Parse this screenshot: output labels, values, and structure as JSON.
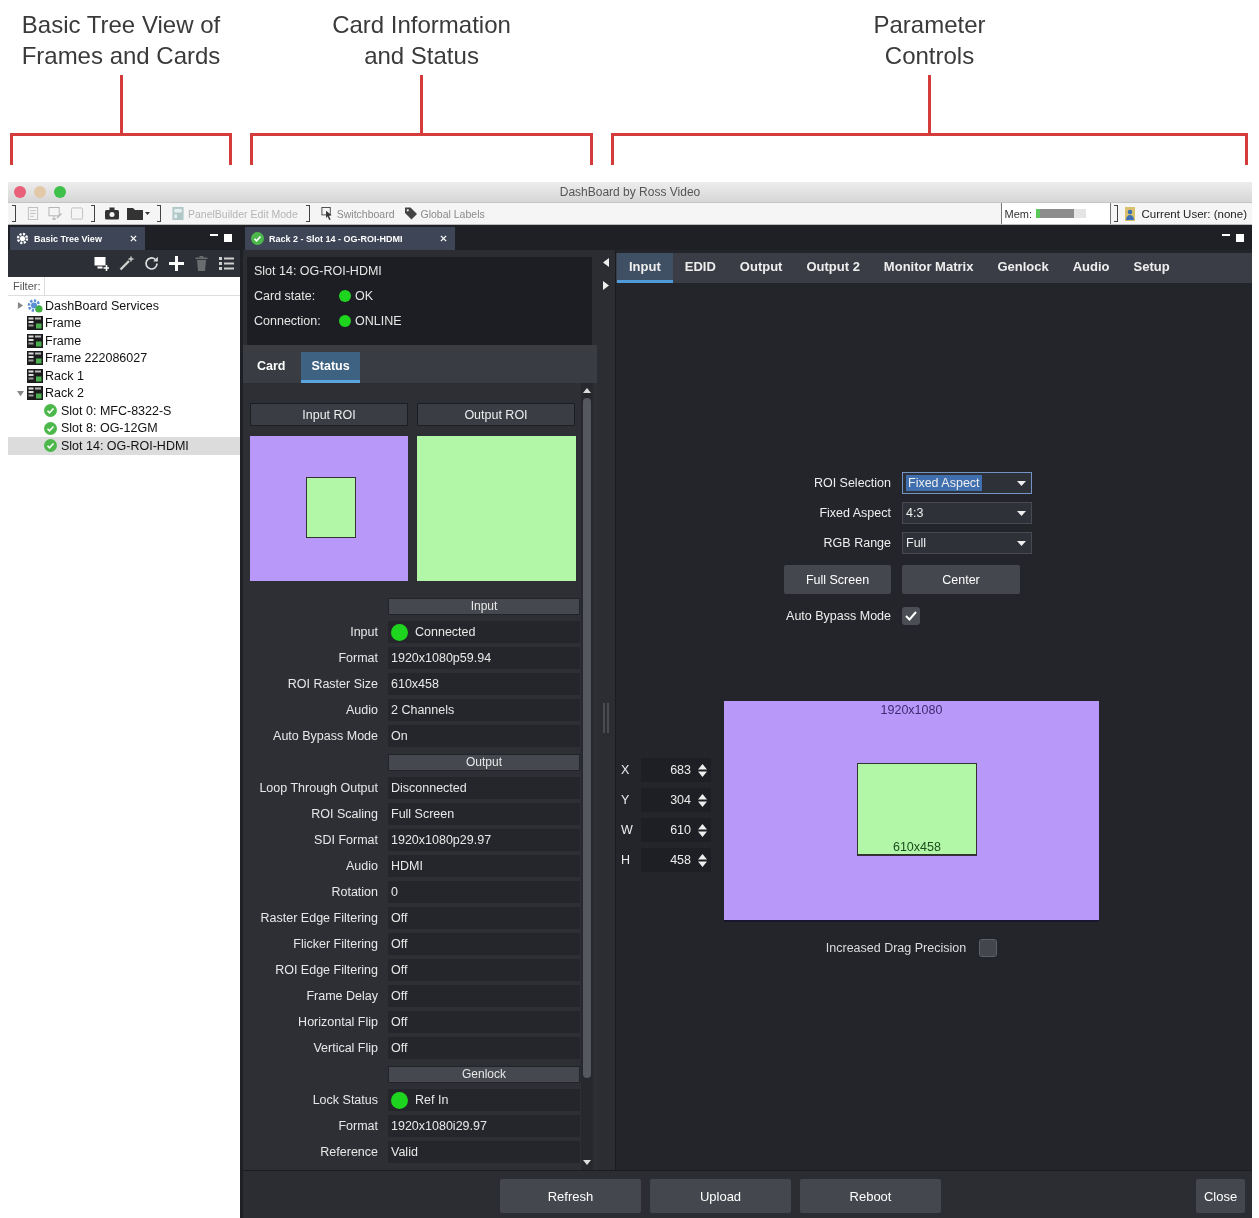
{
  "annotations": [
    {
      "text": "Basic Tree View of\nFrames and Cards"
    },
    {
      "text": "Card Information\nand Status"
    },
    {
      "text": "Parameter\nControls"
    }
  ],
  "window": {
    "title": "DashBoard by Ross Video"
  },
  "toolbar": {
    "icon_buttons": [
      {
        "disabled": true
      },
      {
        "disabled": true
      },
      {
        "disabled": true
      },
      {
        "disabled": false
      },
      {
        "disabled": false
      }
    ],
    "buttons": [
      {
        "label": "PanelBuilder Edit Mode",
        "disabled": true
      },
      {
        "label": "Switchboard",
        "disabled": false
      },
      {
        "label": "Global Labels",
        "disabled": false
      }
    ],
    "memory": {
      "label": "Mem:",
      "level": 0.75
    },
    "user": "Current User: (none)"
  },
  "tree_panel": {
    "tab": {
      "label": "Basic Tree View",
      "selected": true
    },
    "tools": [
      {
        "disabled": false
      },
      {
        "disabled": false
      },
      {
        "disabled": false
      },
      {
        "disabled": false
      },
      {
        "disabled": true
      },
      {
        "disabled": false
      }
    ],
    "filter_label": "Filter:",
    "items": [
      {
        "label": "DashBoard Services",
        "kind": "service",
        "expanded": false,
        "selected": false
      },
      {
        "label": "Frame",
        "kind": "frame",
        "selected": false
      },
      {
        "label": "Frame",
        "kind": "frame",
        "selected": false
      },
      {
        "label": "Frame 222086027",
        "kind": "frame",
        "selected": false
      },
      {
        "label": "Rack 1",
        "kind": "frame",
        "selected": false
      },
      {
        "label": "Rack 2",
        "kind": "frame",
        "expanded": true,
        "selected": false,
        "children": [
          {
            "label": "Slot 0: MFC-8322-S",
            "kind": "card",
            "selected": false
          },
          {
            "label": "Slot 8: OG-12GM",
            "kind": "card",
            "selected": false
          },
          {
            "label": "Slot 14: OG-ROI-HDMI",
            "kind": "card",
            "selected": true
          }
        ]
      }
    ]
  },
  "card_panel": {
    "tab": {
      "label": "Rack 2 - Slot 14 - OG-ROI-HDMI",
      "selected": true
    },
    "info": {
      "title": "Slot 14: OG-ROI-HDMI",
      "fields": [
        {
          "label": "Card state:",
          "value": "OK",
          "color": "#1fd41f"
        },
        {
          "label": "Connection:",
          "value": "ONLINE",
          "color": "#1fd41f"
        }
      ]
    },
    "tabs": [
      {
        "label": "Card",
        "selected": false
      },
      {
        "label": "Status",
        "selected": true
      }
    ],
    "roi_buttons": [
      "Input ROI",
      "Output ROI"
    ],
    "sections": [
      {
        "title": "Input",
        "rows": [
          {
            "label": "Input",
            "value": "Connected",
            "color": "#1fd41f"
          },
          {
            "label": "Format",
            "value": "1920x1080p59.94"
          },
          {
            "label": "ROI Raster Size",
            "value": "610x458"
          },
          {
            "label": "Audio",
            "value": "2 Channels"
          },
          {
            "label": "Auto Bypass Mode",
            "value": "On"
          }
        ]
      },
      {
        "title": "Output",
        "rows": [
          {
            "label": "Loop Through Output",
            "value": "Disconnected"
          },
          {
            "label": "ROI Scaling",
            "value": "Full Screen"
          },
          {
            "label": "SDI Format",
            "value": "1920x1080p29.97"
          },
          {
            "label": "Audio",
            "value": "HDMI"
          },
          {
            "label": "Rotation",
            "value": "0"
          },
          {
            "label": "Raster Edge Filtering",
            "value": "Off"
          },
          {
            "label": "Flicker Filtering",
            "value": "Off"
          },
          {
            "label": "ROI Edge Filtering",
            "value": "Off"
          },
          {
            "label": "Frame Delay",
            "value": "Off"
          },
          {
            "label": "Horizontal Flip",
            "value": "Off"
          },
          {
            "label": "Vertical Flip",
            "value": "Off"
          }
        ]
      },
      {
        "title": "Genlock",
        "rows": [
          {
            "label": "Lock Status",
            "value": "Ref In",
            "color": "#1fd41f"
          },
          {
            "label": "Format",
            "value": "1920x1080i29.97"
          },
          {
            "label": "Reference",
            "value": "Valid"
          }
        ]
      }
    ]
  },
  "parameters": {
    "tabs": [
      {
        "label": "Input",
        "selected": true
      },
      {
        "label": "EDID",
        "selected": false
      },
      {
        "label": "Output",
        "selected": false
      },
      {
        "label": "Output 2",
        "selected": false
      },
      {
        "label": "Monitor Matrix",
        "selected": false
      },
      {
        "label": "Genlock",
        "selected": false
      },
      {
        "label": "Audio",
        "selected": false
      },
      {
        "label": "Setup",
        "selected": false
      }
    ],
    "fields": [
      {
        "label": "ROI Selection",
        "value": "Fixed Aspect",
        "focused": true
      },
      {
        "label": "Fixed Aspect",
        "value": "4:3",
        "focused": false
      },
      {
        "label": "RGB Range",
        "value": "Full",
        "focused": false
      }
    ],
    "buttons": [
      "Full Screen",
      "Center"
    ],
    "auto_bypass": {
      "label": "Auto Bypass Mode",
      "checked": true
    },
    "canvas": {
      "frame_label": "1920x1080",
      "roi_label": "610x458",
      "spinners": [
        {
          "label": "X",
          "value": "683"
        },
        {
          "label": "Y",
          "value": "304"
        },
        {
          "label": "W",
          "value": "610"
        },
        {
          "label": "H",
          "value": "458"
        }
      ]
    },
    "drag_precision": {
      "label": "Increased Drag Precision",
      "checked": false
    }
  },
  "footer": {
    "buttons": [
      "Refresh",
      "Upload",
      "Reboot"
    ],
    "close": "Close"
  }
}
